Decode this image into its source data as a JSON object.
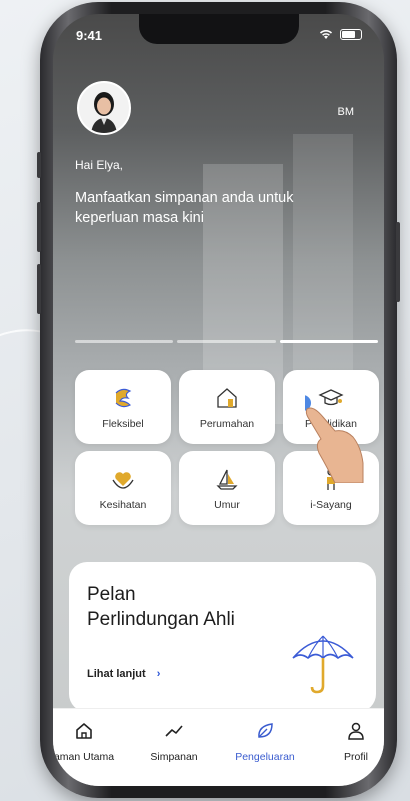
{
  "status_bar": {
    "time": "9:41"
  },
  "header": {
    "badge": "BM"
  },
  "hero": {
    "greeting": "Hai Elya,",
    "tagline": "Manfaatkan simpanan anda untuk keperluan masa kini",
    "slides": 3,
    "active_slide": 3
  },
  "categories": [
    {
      "label": "Fleksibel",
      "icon": "flexible-icon"
    },
    {
      "label": "Perumahan",
      "icon": "house-icon"
    },
    {
      "label": "Pendidikan",
      "icon": "graduation-cap-icon"
    },
    {
      "label": "Kesihatan",
      "icon": "heart-hand-icon"
    },
    {
      "label": "Umur",
      "icon": "sailboat-icon"
    },
    {
      "label": "i-Sayang",
      "icon": "person-icon"
    }
  ],
  "promo": {
    "title_line1": "Pelan",
    "title_line2": "Perlindungan Ahli",
    "link": "Lihat lanjut",
    "link_chevron": "›"
  },
  "tabs": [
    {
      "label": "aman Utama",
      "icon": "home-icon"
    },
    {
      "label": "Simpanan",
      "icon": "trend-line-icon"
    },
    {
      "label": "Pengeluaran",
      "icon": "leaf-icon",
      "active": true
    },
    {
      "label": "Profil",
      "icon": "profile-icon"
    }
  ],
  "colors": {
    "accent": "#3a5ccf",
    "icon_gold": "#e0a92c",
    "icon_blue": "#3b5bd6"
  }
}
